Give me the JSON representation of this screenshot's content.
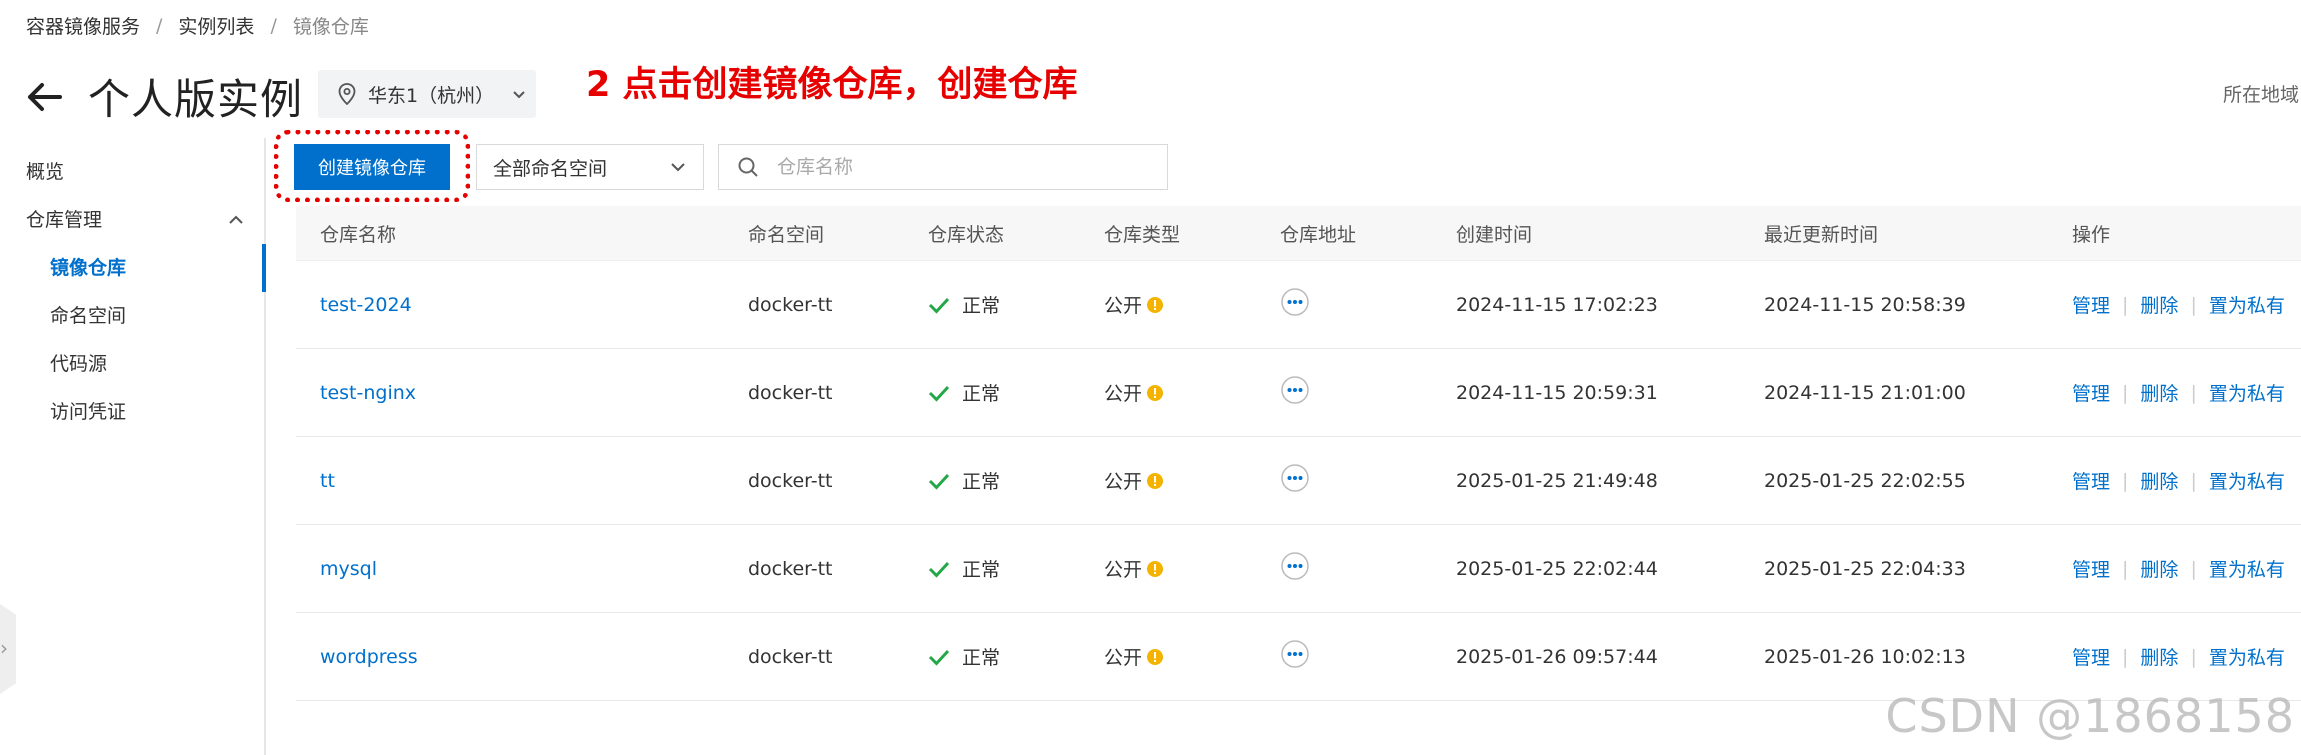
{
  "breadcrumb": [
    "容器镜像服务",
    "实例列表",
    "镜像仓库"
  ],
  "page_title": "个人版实例",
  "region": "华东1（杭州）",
  "annotation": "2 点击创建镜像仓库，创建仓库",
  "region_note": "所在地域",
  "sidebar": {
    "overview": "概览",
    "group": "仓库管理",
    "items": [
      "镜像仓库",
      "命名空间",
      "代码源",
      "访问凭证"
    ]
  },
  "toolbar": {
    "create_label": "创建镜像仓库",
    "namespace_select": "全部命名空间",
    "search_placeholder": "仓库名称"
  },
  "table": {
    "headers": [
      "仓库名称",
      "命名空间",
      "仓库状态",
      "仓库类型",
      "仓库地址",
      "创建时间",
      "最近更新时间",
      "操作"
    ],
    "rows": [
      {
        "name": "test-2024",
        "ns": "docker-tt",
        "status": "正常",
        "type": "公开",
        "created": "2024-11-15 17:02:23",
        "updated": "2024-11-15 20:58:39"
      },
      {
        "name": "test-nginx",
        "ns": "docker-tt",
        "status": "正常",
        "type": "公开",
        "created": "2024-11-15 20:59:31",
        "updated": "2024-11-15 21:01:00"
      },
      {
        "name": "tt",
        "ns": "docker-tt",
        "status": "正常",
        "type": "公开",
        "created": "2025-01-25 21:49:48",
        "updated": "2025-01-25 22:02:55"
      },
      {
        "name": "mysql",
        "ns": "docker-tt",
        "status": "正常",
        "type": "公开",
        "created": "2025-01-25 22:02:44",
        "updated": "2025-01-25 22:04:33"
      },
      {
        "name": "wordpress",
        "ns": "docker-tt",
        "status": "正常",
        "type": "公开",
        "created": "2025-01-26 09:57:44",
        "updated": "2025-01-26 10:02:13"
      }
    ],
    "ops": [
      "管理",
      "删除",
      "置为私有"
    ]
  },
  "watermark": "CSDN @1868158",
  "colors": {
    "accent": "#0070cc",
    "success": "#22a846",
    "warning": "#f5b301",
    "annotation": "#e60000"
  }
}
